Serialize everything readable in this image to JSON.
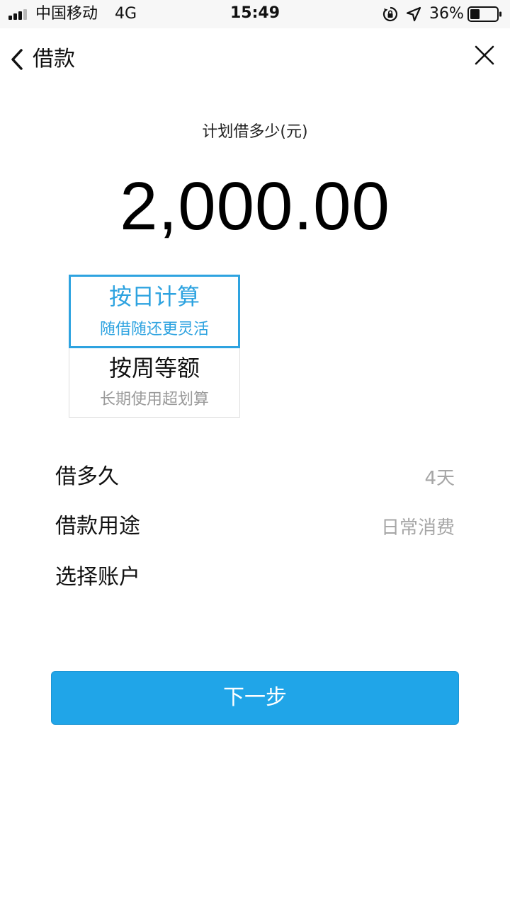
{
  "status_bar": {
    "carrier": "中国移动",
    "network": "4G",
    "time": "15:49",
    "battery_percent": "36%",
    "battery_level": 0.36,
    "icons": [
      "signal-icon",
      "orientation-lock-icon",
      "location-arrow-icon",
      "battery-icon"
    ]
  },
  "nav": {
    "back_icon": "chevron-left-icon",
    "title": "借款",
    "close_icon": "close-icon"
  },
  "amount": {
    "label": "计划借多少(元)",
    "value": "2,000.00"
  },
  "repayment_options": [
    {
      "title": "按日计算",
      "subtitle": "随借随还更灵活",
      "selected": true
    },
    {
      "title": "按周等额",
      "subtitle": "长期使用超划算",
      "selected": false
    }
  ],
  "form": {
    "duration": {
      "label": "借多久",
      "value": "4天"
    },
    "purpose": {
      "label": "借款用途",
      "value": "日常消费"
    },
    "account": {
      "label": "选择账户",
      "value": ""
    }
  },
  "next_button": {
    "label": "下一步"
  },
  "colors": {
    "accent": "#2ea3e0",
    "button": "#20a5e8",
    "muted_text": "#a6a6a6",
    "status_bar_bg": "#f7f7f7"
  }
}
